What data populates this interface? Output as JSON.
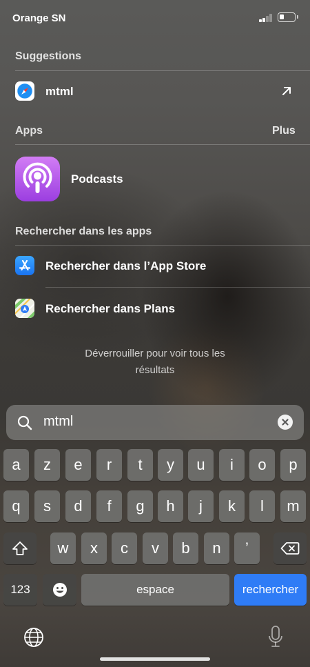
{
  "status_bar": {
    "carrier": "Orange SN",
    "signal_bars_filled": 2,
    "battery_level": 0.2
  },
  "suggestions": {
    "title": "Suggestions",
    "items": [
      {
        "label": "mtml",
        "icon": "safari-compass-icon",
        "action_icon": "arrow-up-right-icon"
      }
    ]
  },
  "apps": {
    "title": "Apps",
    "more_label": "Plus",
    "items": [
      {
        "label": "Podcasts",
        "icon": "podcasts-icon"
      }
    ]
  },
  "search_in_apps": {
    "title": "Rechercher dans les apps",
    "items": [
      {
        "label": "Rechercher dans l’App Store",
        "icon": "app-store-icon"
      },
      {
        "label": "Rechercher dans Plans",
        "icon": "maps-icon"
      }
    ]
  },
  "unlock_message": {
    "line1": "Déverrouiller pour voir tous les",
    "line2": "résultats"
  },
  "search": {
    "value": "mtml",
    "icon": "search-icon",
    "clear_icon": "clear-icon"
  },
  "keyboard": {
    "row1": [
      "a",
      "z",
      "e",
      "r",
      "t",
      "y",
      "u",
      "i",
      "o",
      "p"
    ],
    "row2": [
      "q",
      "s",
      "d",
      "f",
      "g",
      "h",
      "j",
      "k",
      "l",
      "m"
    ],
    "row3": [
      "w",
      "x",
      "c",
      "v",
      "b",
      "n",
      "’"
    ],
    "numbers_label": "123",
    "space_label": "espace",
    "return_label": "rechercher",
    "shift_icon": "shift-icon",
    "delete_icon": "delete-icon",
    "emoji_icon": "emoji-icon",
    "globe_icon": "globe-icon",
    "mic_icon": "microphone-icon",
    "return_color": "#2f7cf6"
  }
}
